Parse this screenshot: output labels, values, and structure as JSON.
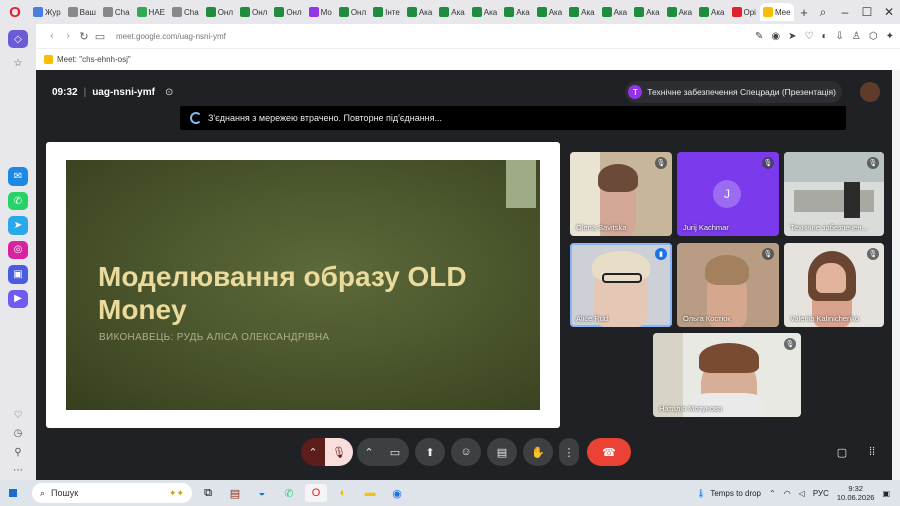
{
  "browser": {
    "tabs": [
      {
        "label": "Жур",
        "color": "#4a7de0"
      },
      {
        "label": "Ваш",
        "color": "#888"
      },
      {
        "label": "Cha",
        "color": "#888"
      },
      {
        "label": "HAE",
        "color": "#34a853"
      },
      {
        "label": "Cha",
        "color": "#888"
      },
      {
        "label": "Онл",
        "color": "#1e8e3e"
      },
      {
        "label": "Онл",
        "color": "#1e8e3e"
      },
      {
        "label": "Онл",
        "color": "#1e8e3e"
      },
      {
        "label": "Мо",
        "color": "#9334e6"
      },
      {
        "label": "Онл",
        "color": "#1e8e3e"
      },
      {
        "label": "Інте",
        "color": "#1e8e3e"
      },
      {
        "label": "Ака",
        "color": "#1e8e3e"
      },
      {
        "label": "Ака",
        "color": "#1e8e3e"
      },
      {
        "label": "Ака",
        "color": "#1e8e3e"
      },
      {
        "label": "Ака",
        "color": "#1e8e3e"
      },
      {
        "label": "Ака",
        "color": "#1e8e3e"
      },
      {
        "label": "Ака",
        "color": "#1e8e3e"
      },
      {
        "label": "Ака",
        "color": "#1e8e3e"
      },
      {
        "label": "Ака",
        "color": "#1e8e3e"
      },
      {
        "label": "Ака",
        "color": "#1e8e3e"
      },
      {
        "label": "Ака",
        "color": "#1e8e3e"
      },
      {
        "label": "Opi",
        "color": "#e0202a"
      },
      {
        "label": "Mee",
        "color": "#fbbc04",
        "active": true
      }
    ],
    "url": "meet.google.com/uag-nsni-ymf",
    "bookmark": "Meet: \"chs-ehnh-osj\"",
    "new_tab": "+"
  },
  "meet": {
    "time": "09:32",
    "separator": "|",
    "code": "uag-nsni-ymf",
    "presenter_initial": "T",
    "presenter": "Технічне забезпечення Спецради (Презентація)",
    "banner": "З'єднання з мережею втрачено. Повторне під'єднання..."
  },
  "slide": {
    "title": "Моделювання образу OLD Money",
    "subtitle": "ВИКОНАВЕЦЬ: РУДЬ АЛІСА ОЛЕКСАНДРІВНА"
  },
  "participants": [
    {
      "name": "Olena Savitska"
    },
    {
      "name": "Jurij Kachmar",
      "initial": "J"
    },
    {
      "name": "Технічне забезпечен..."
    },
    {
      "name": "Alice Rud"
    },
    {
      "name": "Ольга Костюк"
    },
    {
      "name": "Valeriia Kalinichenko"
    },
    {
      "name": "Наталія Мотунова"
    }
  ],
  "taskbar": {
    "search": "Пошук",
    "weather": "Temps to drop",
    "language": "РУС",
    "time": "9:32",
    "date": "10.06.2026"
  },
  "colors": {
    "meet_bg": "#202124",
    "end_call": "#ea4335",
    "mic_off": "#f9dedc"
  }
}
